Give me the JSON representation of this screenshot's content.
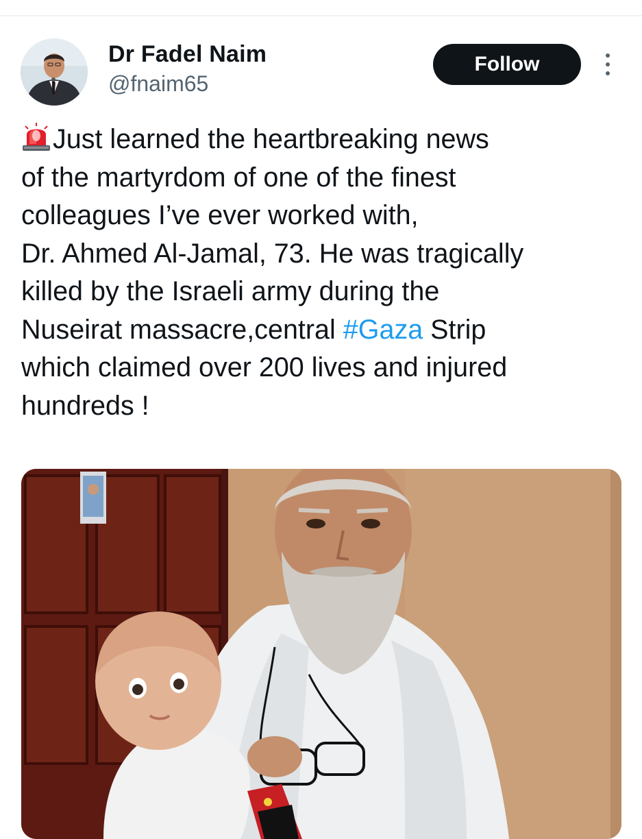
{
  "tweet": {
    "author": {
      "name": "Dr Fadel Naim",
      "handle": "@fnaim65",
      "avatar_icon": "profile-photo"
    },
    "follow_label": "Follow",
    "more_icon": "more-vertical-icon",
    "emoji": "police-car-light",
    "text_lines": [
      "Just learned the heartbreaking news",
      "of the martyrdom of one of the finest",
      "colleagues I’ve ever worked with,",
      "Dr. Ahmed Al-Jamal, 73. He was tragically",
      "killed by the Israeli army during the",
      "Nuseirat massacre,central ",
      "which claimed over 200 lives and injured",
      "hundreds !"
    ],
    "hashtag": "#Gaza",
    "text_after_hashtag": " Strip",
    "media": {
      "type": "photo"
    }
  },
  "colors": {
    "text_primary": "#0f1419",
    "text_secondary": "#536471",
    "link": "#1d9bf0",
    "follow_bg": "#0f1419",
    "follow_text": "#ffffff"
  }
}
